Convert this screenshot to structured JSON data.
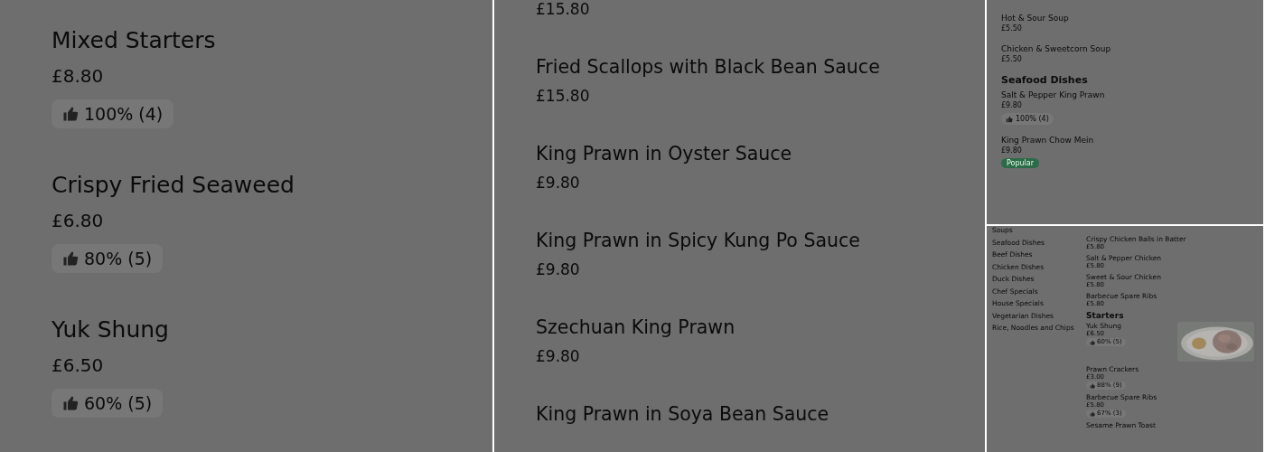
{
  "panels": [
    {
      "kind": "large",
      "items": [
        {
          "kind": "dish",
          "name": "Mixed Starters",
          "price": "£8.80",
          "rating": "100% (4)"
        },
        {
          "kind": "dish",
          "name": "Crispy Fried Seaweed",
          "price": "£6.80",
          "rating": "80% (5)"
        },
        {
          "kind": "dish",
          "name": "Yuk Shung",
          "price": "£6.50",
          "rating": "60% (5)"
        }
      ]
    },
    {
      "kind": "medium",
      "items": [
        {
          "kind": "price",
          "price": "£15.80"
        },
        {
          "kind": "dish",
          "name": "Fried Scallops with Black Bean Sauce",
          "price": "£15.80"
        },
        {
          "kind": "dish",
          "name": "King Prawn in Oyster Sauce",
          "price": "£9.80"
        },
        {
          "kind": "dish",
          "name": "King Prawn in Spicy Kung Po Sauce",
          "price": "£9.80"
        },
        {
          "kind": "dish",
          "name": "Szechuan King Prawn",
          "price": "£9.80"
        },
        {
          "kind": "dish",
          "name": "King Prawn in Soya Bean Sauce"
        }
      ]
    },
    {
      "kind": "small",
      "items": [
        {
          "kind": "dish",
          "name": "Hot & Sour Soup",
          "price": "£5.50"
        },
        {
          "kind": "dish",
          "name": "Chicken & Sweetcorn Soup",
          "price": "£5.50"
        },
        {
          "kind": "heading",
          "name": "Seafood Dishes"
        },
        {
          "kind": "dish",
          "name": "Salt & Pepper King Prawn",
          "price": "£9.80",
          "rating": "100% (4)"
        },
        {
          "kind": "dish",
          "name": "King Prawn Chow Mein",
          "price": "£9.80",
          "badge": "Popular"
        }
      ]
    },
    {
      "kind": "tiny",
      "sidebar": [
        "Soups",
        "Seafood Dishes",
        "Beef Dishes",
        "Chicken Dishes",
        "Duck Dishes",
        "Chef Specials",
        "House Specials",
        "Vegetarian Dishes",
        "Rice, Noodles and Chips"
      ],
      "items": [
        {
          "kind": "dish",
          "name": "Crispy Chicken Balls in Batter",
          "price": "£5.80"
        },
        {
          "kind": "dish",
          "name": "Salt & Pepper Chicken",
          "price": "£5.80"
        },
        {
          "kind": "dish",
          "name": "Sweet & Sour Chicken",
          "price": "£5.80"
        },
        {
          "kind": "dish",
          "name": "Barbecue Spare Ribs",
          "price": "£5.80"
        },
        {
          "kind": "heading",
          "name": "Starters"
        },
        {
          "kind": "dish",
          "name": "Yuk Shung",
          "price": "£6.50",
          "rating": "60% (5)",
          "photo": true
        },
        {
          "kind": "dish",
          "name": "Prawn Crackers",
          "price": "£3.00",
          "rating": "88% (9)"
        },
        {
          "kind": "dish",
          "name": "Barbecue Spare Ribs",
          "price": "£5.80",
          "rating": "67% (3)"
        },
        {
          "kind": "dish",
          "name": "Sesame Prawn Toast"
        }
      ]
    }
  ]
}
